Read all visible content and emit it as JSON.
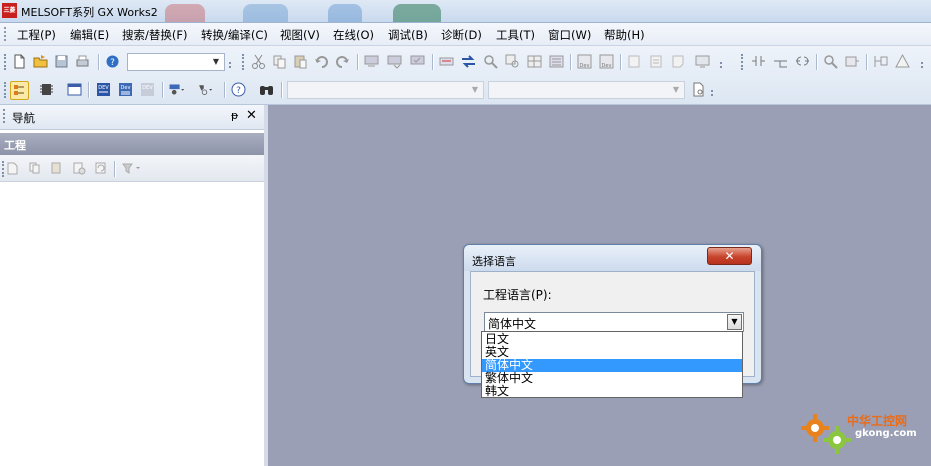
{
  "window": {
    "title": "MELSOFT系列 GX Works2",
    "app_icon_glyph": "三菱",
    "accent_color": "#c8201c"
  },
  "menu": {
    "items": [
      {
        "label": "工程(P)"
      },
      {
        "label": "编辑(E)"
      },
      {
        "label": "搜索/替换(F)"
      },
      {
        "label": "转换/编译(C)"
      },
      {
        "label": "视图(V)"
      },
      {
        "label": "在线(O)"
      },
      {
        "label": "调试(B)"
      },
      {
        "label": "诊断(D)"
      },
      {
        "label": "工具(T)"
      },
      {
        "label": "窗口(W)"
      },
      {
        "label": "帮助(H)"
      }
    ]
  },
  "toolbar": {
    "row1_combo_value": "",
    "row2_combo1_value": "",
    "row2_combo2_value": ""
  },
  "nav": {
    "title": "导航",
    "pin_glyph": "ᵽ",
    "close_glyph": "✕",
    "section_label": "工程"
  },
  "dialog": {
    "title": "选择语言",
    "close_glyph": "✕",
    "field_label": "工程语言(P):",
    "selected_value": "简体中文",
    "options": [
      {
        "label": "日文",
        "selected": false
      },
      {
        "label": "英文",
        "selected": false
      },
      {
        "label": "简体中文",
        "selected": true
      },
      {
        "label": "繁体中文",
        "selected": false
      },
      {
        "label": "韩文",
        "selected": false
      }
    ]
  },
  "watermark": {
    "brand": "中华工控网",
    "domain": "gkong.com"
  },
  "colors": {
    "workspace_bg": "#9b9fb5",
    "selection": "#3399ff",
    "nav_section": "#8d93a8"
  }
}
